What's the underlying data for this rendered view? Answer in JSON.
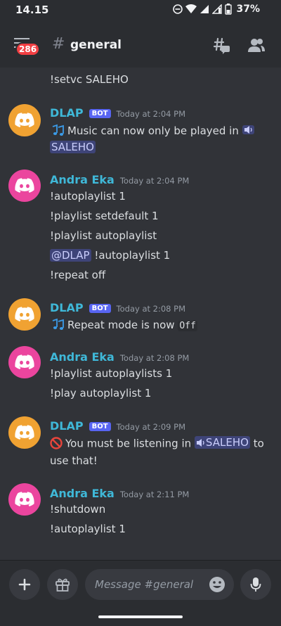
{
  "status_bar": {
    "time": "14.15",
    "battery": "37%"
  },
  "header": {
    "badge_count": "286",
    "hash": "#",
    "channel_name": "general"
  },
  "messages": {
    "partial_line": "!setvc SALEHO",
    "m1": {
      "username": "DLAP",
      "bot_tag": "BOT",
      "time": "Today at 2:04 PM",
      "text_before": "Music can now only be played in",
      "channel_mention": "SALEHO"
    },
    "m2": {
      "username": "Andra Eka",
      "time": "Today at 2:04 PM",
      "lines": [
        "!autoplaylist 1",
        "!playlist setdefault 1",
        "!playlist autoplaylist",
        "!repeat off"
      ],
      "mention": "@DLAP",
      "mention_rest": "!autoplaylist 1"
    },
    "m3": {
      "username": "DLAP",
      "bot_tag": "BOT",
      "time": "Today at 2:08 PM",
      "text": "Repeat mode is now",
      "code": "Off"
    },
    "m4": {
      "username": "Andra Eka",
      "time": "Today at 2:08 PM",
      "lines": [
        "!playlist autoplaylists 1",
        "!play autoplaylist 1"
      ]
    },
    "m5": {
      "username": "DLAP",
      "bot_tag": "BOT",
      "time": "Today at 2:09 PM",
      "text_before": "You must be listening in",
      "channel_mention": "SALEHO",
      "text_after": "to",
      "line2": "use that!"
    },
    "m6": {
      "username": "Andra Eka",
      "time": "Today at 2:11 PM",
      "lines": [
        "!shutdown",
        "!autoplaylist 1"
      ]
    }
  },
  "composer": {
    "placeholder": "Message #general"
  },
  "colors": {
    "background": "#313338",
    "accent": "#5865f2",
    "username": "#3fb8d8",
    "badge": "#f23f43"
  }
}
